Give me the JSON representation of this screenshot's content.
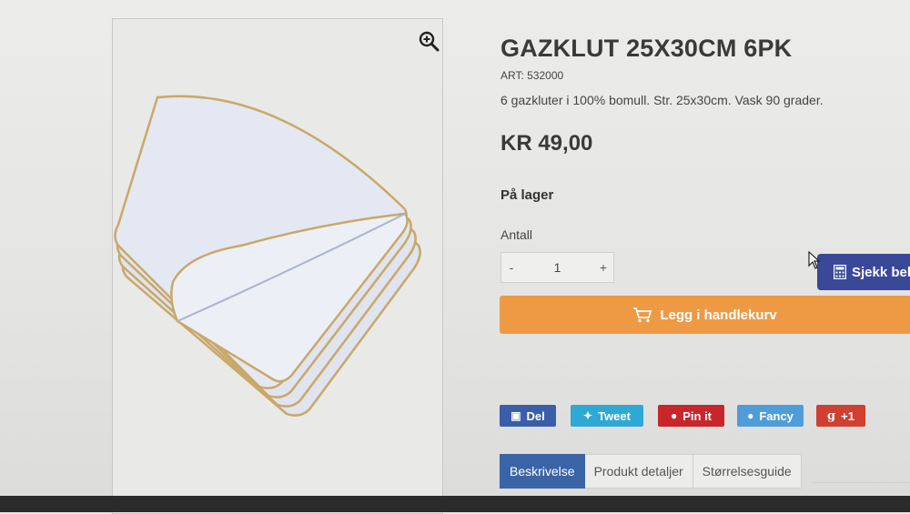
{
  "product": {
    "title": "GAZKLUT 25X30CM 6PK",
    "art": "ART: 532000",
    "description": "6 gazkluter i 100% bomull. Str. 25x30cm. Vask 90 grader.",
    "price": "KR 49,00",
    "stock": "På lager"
  },
  "quantity": {
    "label": "Antall",
    "minus": "-",
    "value": "1",
    "plus": "+"
  },
  "buttons": {
    "calculate": "Sjekk beh",
    "add_to_cart": "Legg i handlekurv"
  },
  "share": {
    "facebook": "Del",
    "twitter": "Tweet",
    "pinterest": "Pin it",
    "fancy": "Fancy",
    "gplus": "+1",
    "gplus_glyph": "g"
  },
  "tabs": [
    {
      "label": "Beskrivelse",
      "active": true
    },
    {
      "label": "Produkt detaljer",
      "active": false
    },
    {
      "label": "Størrelsesguide",
      "active": false
    }
  ],
  "colors": {
    "cart": "#ee9a45",
    "calc": "#3a4898",
    "active_tab": "#3b64a6",
    "facebook": "#3b5ea8",
    "twitter": "#2ea9d6",
    "pinterest": "#c8262b",
    "fancy": "#4f9dd8",
    "gplus": "#d04030"
  },
  "icons": [
    "zoom-in-icon",
    "calculator-icon",
    "cart-icon",
    "facebook-icon",
    "twitter-icon",
    "pinterest-icon",
    "fancy-icon",
    "google-plus-icon",
    "mouse-cursor-icon"
  ]
}
